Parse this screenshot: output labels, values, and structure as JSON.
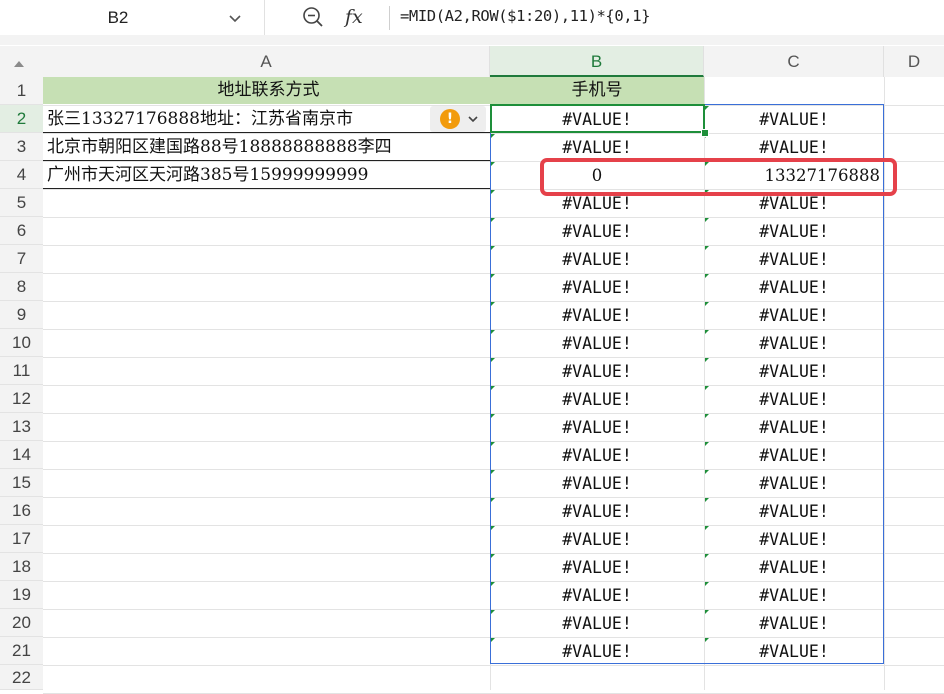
{
  "formula_bar": {
    "name_box": "B2",
    "fx_icon": "fx",
    "formula": "=MID(A2,ROW($1:20),11)*{0,1}"
  },
  "columns": [
    "A",
    "B",
    "C",
    "D"
  ],
  "rows": [
    "1",
    "2",
    "3",
    "4",
    "5",
    "6",
    "7",
    "8",
    "9",
    "10",
    "11",
    "12",
    "13",
    "14",
    "15",
    "16",
    "17",
    "18",
    "19",
    "20",
    "21",
    "22"
  ],
  "sheet": {
    "A1": "地址联系方式",
    "B1": "手机号",
    "A2": "张三13327176888地址：江苏省南京市",
    "A3": "北京市朝阳区建国路88号18888888888李四",
    "A4": "广州市天河区天河路385号15999999999",
    "B_values": [
      "#VALUE!",
      "#VALUE!",
      "0",
      "#VALUE!",
      "#VALUE!",
      "#VALUE!",
      "#VALUE!",
      "#VALUE!",
      "#VALUE!",
      "#VALUE!",
      "#VALUE!",
      "#VALUE!",
      "#VALUE!",
      "#VALUE!",
      "#VALUE!",
      "#VALUE!",
      "#VALUE!",
      "#VALUE!",
      "#VALUE!",
      "#VALUE!"
    ],
    "C_values": [
      "#VALUE!",
      "#VALUE!",
      "13327176888",
      "#VALUE!",
      "#VALUE!",
      "#VALUE!",
      "#VALUE!",
      "#VALUE!",
      "#VALUE!",
      "#VALUE!",
      "#VALUE!",
      "#VALUE!",
      "#VALUE!",
      "#VALUE!",
      "#VALUE!",
      "#VALUE!",
      "#VALUE!",
      "#VALUE!",
      "#VALUE!",
      "#VALUE!"
    ]
  },
  "selection": {
    "active_column": "B",
    "active_row": "2"
  },
  "colors": {
    "header_fill": "#c6e0b4",
    "selection_green": "#1e8f3a",
    "spill_border": "#3a6fd8",
    "highlight_red": "#e5414a",
    "warning_orange": "#f29b0c"
  },
  "icons": [
    "chevron-down-icon",
    "zoom-out-icon",
    "fx-icon",
    "warning-icon",
    "chevron-down-icon"
  ]
}
